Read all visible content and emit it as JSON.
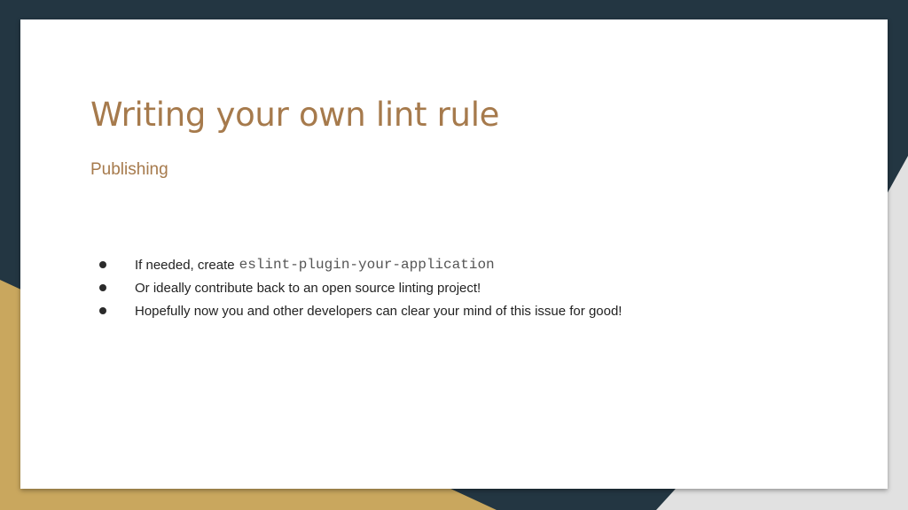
{
  "slide": {
    "title": "Writing your own lint rule",
    "subtitle": "Publishing",
    "bullets": [
      {
        "text": "If needed, create",
        "code": "eslint-plugin-your-application"
      },
      {
        "text": "Or ideally contribute back to an open source linting project!"
      },
      {
        "text": "Hopefully now you and other developers can clear your mind of this issue for good!"
      }
    ]
  },
  "colors": {
    "background_dark": "#233642",
    "background_gold": "#c9a75e",
    "background_gray": "#e1e1e1",
    "card": "#ffffff",
    "title": "#a67a4c",
    "body_text": "#222222"
  }
}
